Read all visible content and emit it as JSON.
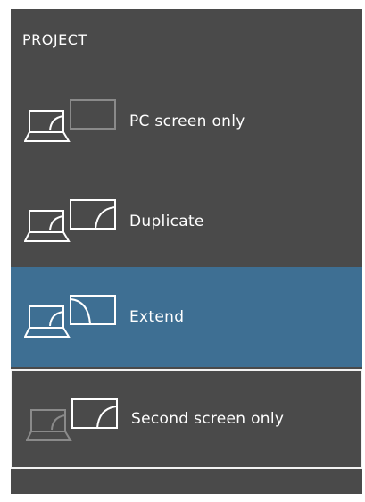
{
  "header": {
    "title": "PROJECT"
  },
  "options": [
    {
      "label": "PC screen only",
      "icon": "pc-screen-only-icon",
      "selected": false,
      "focused": false
    },
    {
      "label": "Duplicate",
      "icon": "duplicate-icon",
      "selected": false,
      "focused": false
    },
    {
      "label": "Extend",
      "icon": "extend-icon",
      "selected": true,
      "focused": false
    },
    {
      "label": "Second screen only",
      "icon": "second-screen-only-icon",
      "selected": false,
      "focused": true
    }
  ],
  "colors": {
    "panel_background": "#4a4a4a",
    "selected_background": "#3e6f93",
    "focus_border": "#f2f2f2",
    "dimmed_icon": "#8a8a8a",
    "icon_stroke": "#ffffff"
  }
}
